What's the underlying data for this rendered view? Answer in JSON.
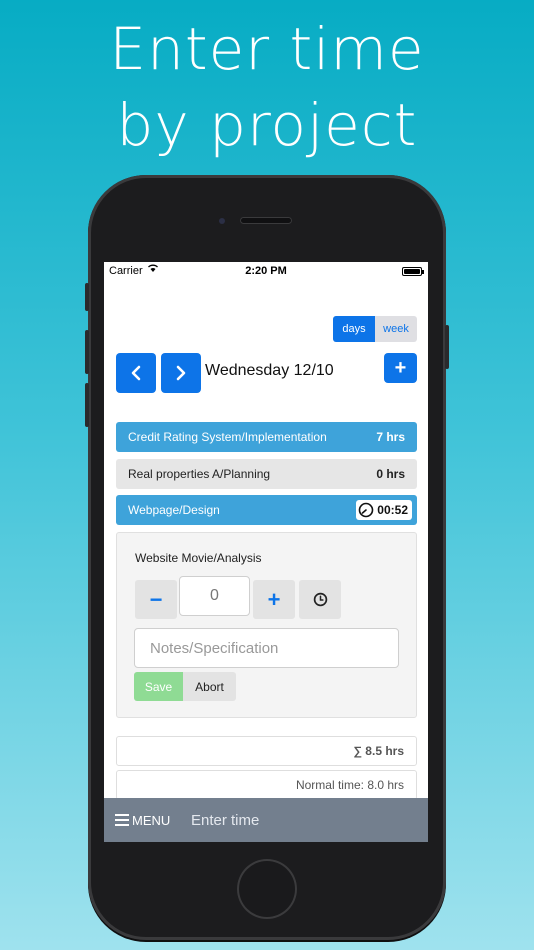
{
  "headline": {
    "line1": "Enter time",
    "line2": "by project"
  },
  "status_bar": {
    "carrier": "Carrier",
    "time": "2:20 PM"
  },
  "view_toggle": {
    "days": "days",
    "week": "week",
    "selected": "days"
  },
  "date_nav": {
    "date": "Wednesday 12/10",
    "add_label": "+"
  },
  "projects": [
    {
      "name": "Credit Rating System/Implementation",
      "hours": "7 hrs"
    },
    {
      "name": "Real properties A/Planning",
      "hours": "0 hrs"
    },
    {
      "name": "Webpage/Design",
      "timer": "00:52"
    }
  ],
  "entry_panel": {
    "title": "Website Movie/Analysis",
    "quantity_value": "0",
    "minus_label": "−",
    "plus_label": "+",
    "notes_placeholder": "Notes/Specification",
    "save_label": "Save",
    "abort_label": "Abort"
  },
  "summary": {
    "total": "∑ 8.5 hrs",
    "normal_time": "Normal time: 8.0 hrs"
  },
  "bottom_bar": {
    "menu_label": "MENU",
    "title": "Enter time"
  },
  "colors": {
    "accent": "#0d74e8",
    "project_blue": "#3ea3da",
    "save_green": "#8fdb94",
    "bottom_bar": "#737f8e"
  }
}
